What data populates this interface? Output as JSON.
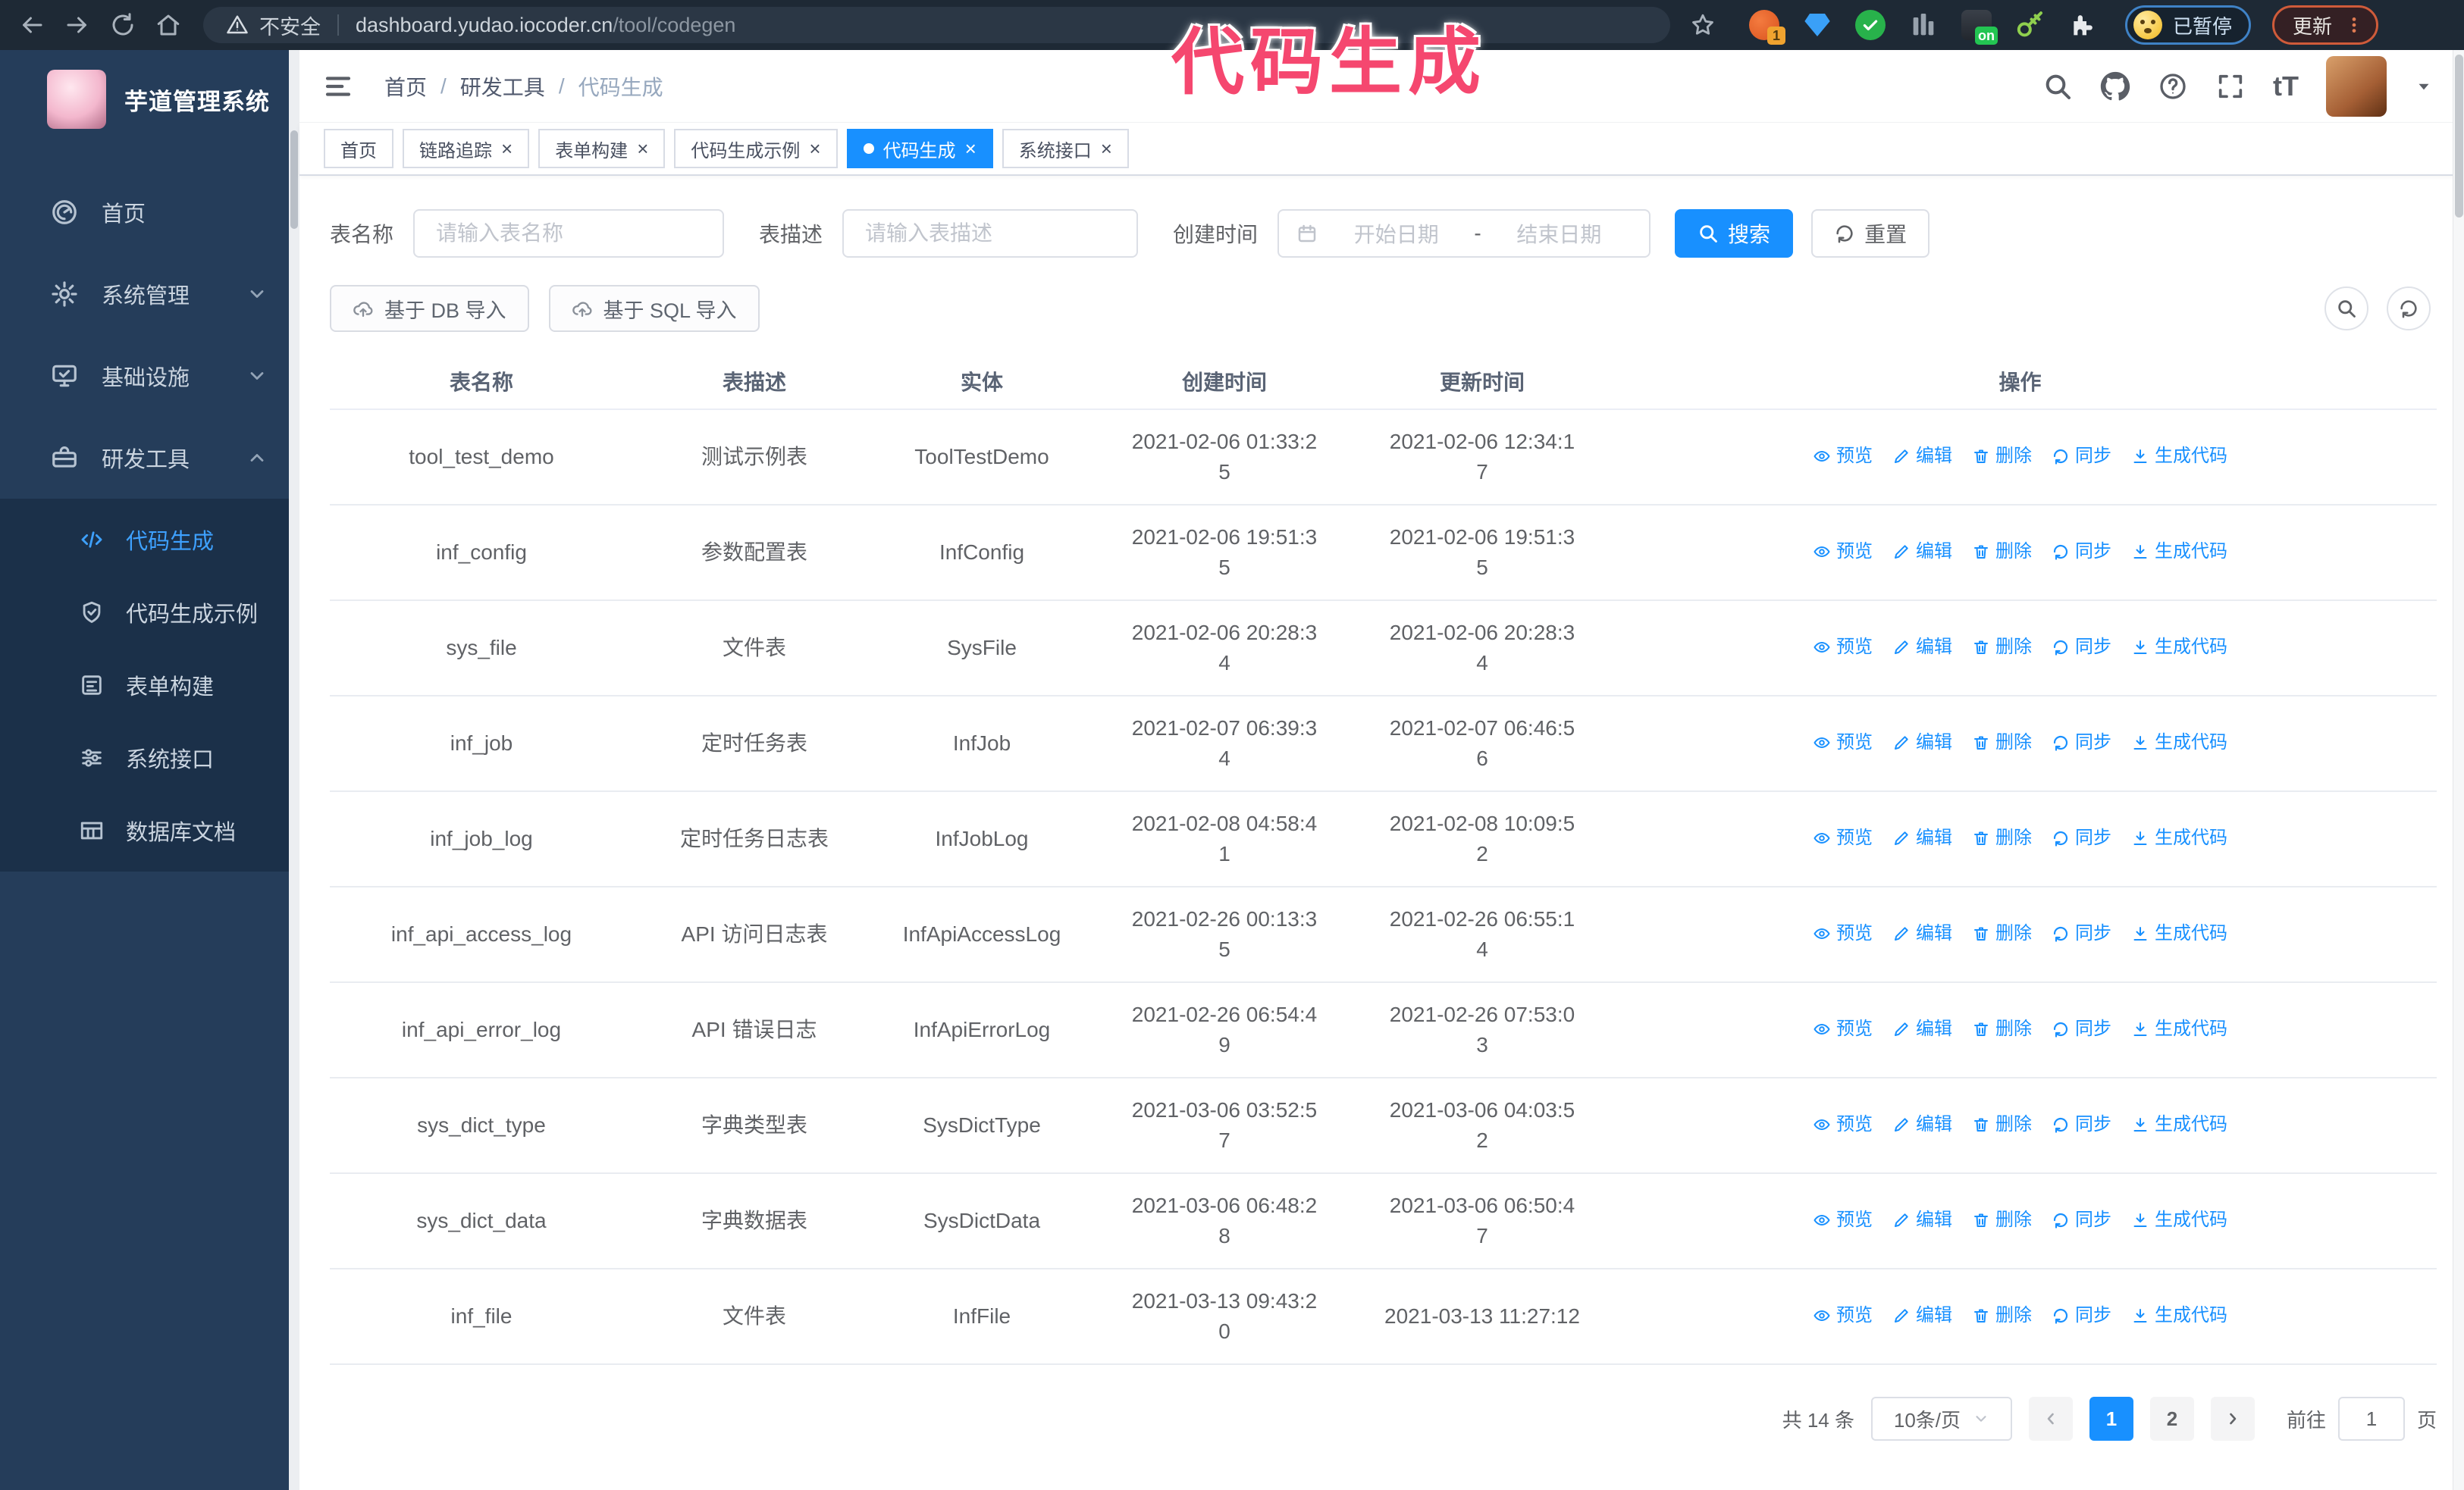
{
  "annotation": {
    "text": "代码生成"
  },
  "browser": {
    "security_label": "不安全",
    "url_host": "dashboard.yudao.iocoder.cn",
    "url_path": "/tool/codegen",
    "ext_badge": "1",
    "ext_on_badge": "on",
    "paused_label": "已暂停",
    "update_label": "更新"
  },
  "sidebar": {
    "logo_title": "芋道管理系统",
    "items": [
      {
        "label": "首页"
      },
      {
        "label": "系统管理"
      },
      {
        "label": "基础设施"
      },
      {
        "label": "研发工具"
      }
    ],
    "submenu": [
      {
        "label": "代码生成"
      },
      {
        "label": "代码生成示例"
      },
      {
        "label": "表单构建"
      },
      {
        "label": "系统接口"
      },
      {
        "label": "数据库文档"
      }
    ]
  },
  "header": {
    "breadcrumb": [
      "首页",
      "研发工具",
      "代码生成"
    ],
    "breadcrumb_separator": "/",
    "font_size_glyph": "tT"
  },
  "ui": {
    "tab_close_glyph": "×"
  },
  "tabs": [
    {
      "label": "首页"
    },
    {
      "label": "链路追踪"
    },
    {
      "label": "表单构建"
    },
    {
      "label": "代码生成示例"
    },
    {
      "label": "代码生成"
    },
    {
      "label": "系统接口"
    }
  ],
  "filters": {
    "table_name_label": "表名称",
    "table_name_placeholder": "请输入表名称",
    "table_desc_label": "表描述",
    "table_desc_placeholder": "请输入表描述",
    "create_time_label": "创建时间",
    "date_start_placeholder": "开始日期",
    "date_separator": "-",
    "date_end_placeholder": "结束日期",
    "search_label": "搜索",
    "reset_label": "重置"
  },
  "toolbar": {
    "import_db_label": "基于 DB 导入",
    "import_sql_label": "基于 SQL 导入"
  },
  "table": {
    "columns": [
      "表名称",
      "表描述",
      "实体",
      "创建时间",
      "更新时间",
      "操作"
    ],
    "actions": [
      "预览",
      "编辑",
      "删除",
      "同步",
      "生成代码"
    ],
    "rows": [
      {
        "name": "tool_test_demo",
        "desc": "测试示例表",
        "entity": "ToolTestDemo",
        "create_time": "2021-02-06 01:33:25",
        "update_time": "2021-02-06 12:34:17"
      },
      {
        "name": "inf_config",
        "desc": "参数配置表",
        "entity": "InfConfig",
        "create_time": "2021-02-06 19:51:35",
        "update_time": "2021-02-06 19:51:35"
      },
      {
        "name": "sys_file",
        "desc": "文件表",
        "entity": "SysFile",
        "create_time": "2021-02-06 20:28:34",
        "update_time": "2021-02-06 20:28:34"
      },
      {
        "name": "inf_job",
        "desc": "定时任务表",
        "entity": "InfJob",
        "create_time": "2021-02-07 06:39:34",
        "update_time": "2021-02-07 06:46:56"
      },
      {
        "name": "inf_job_log",
        "desc": "定时任务日志表",
        "entity": "InfJobLog",
        "create_time": "2021-02-08 04:58:41",
        "update_time": "2021-02-08 10:09:52"
      },
      {
        "name": "inf_api_access_log",
        "desc": "API 访问日志表",
        "entity": "InfApiAccessLog",
        "create_time": "2021-02-26 00:13:35",
        "update_time": "2021-02-26 06:55:14"
      },
      {
        "name": "inf_api_error_log",
        "desc": "API 错误日志",
        "entity": "InfApiErrorLog",
        "create_time": "2021-02-26 06:54:49",
        "update_time": "2021-02-26 07:53:03"
      },
      {
        "name": "sys_dict_type",
        "desc": "字典类型表",
        "entity": "SysDictType",
        "create_time": "2021-03-06 03:52:57",
        "update_time": "2021-03-06 04:03:52"
      },
      {
        "name": "sys_dict_data",
        "desc": "字典数据表",
        "entity": "SysDictData",
        "create_time": "2021-03-06 06:48:28",
        "update_time": "2021-03-06 06:50:47"
      },
      {
        "name": "inf_file",
        "desc": "文件表",
        "entity": "InfFile",
        "create_time": "2021-03-13 09:43:20",
        "update_time": "2021-03-13 11:27:12"
      }
    ]
  },
  "pagination": {
    "total_label": "共 14 条",
    "page_size_label": "10条/页",
    "pages": [
      "1",
      "2"
    ],
    "active_page": "1",
    "goto_label": "前往",
    "goto_value": "1",
    "unit_label": "页"
  },
  "colors": {
    "primary": "#1890ff",
    "annotation_pink": "#f5476f",
    "sidebar_bg": "#253d5a",
    "submenu_bg": "#1b3049",
    "browser_bar_bg": "#1e2935"
  }
}
